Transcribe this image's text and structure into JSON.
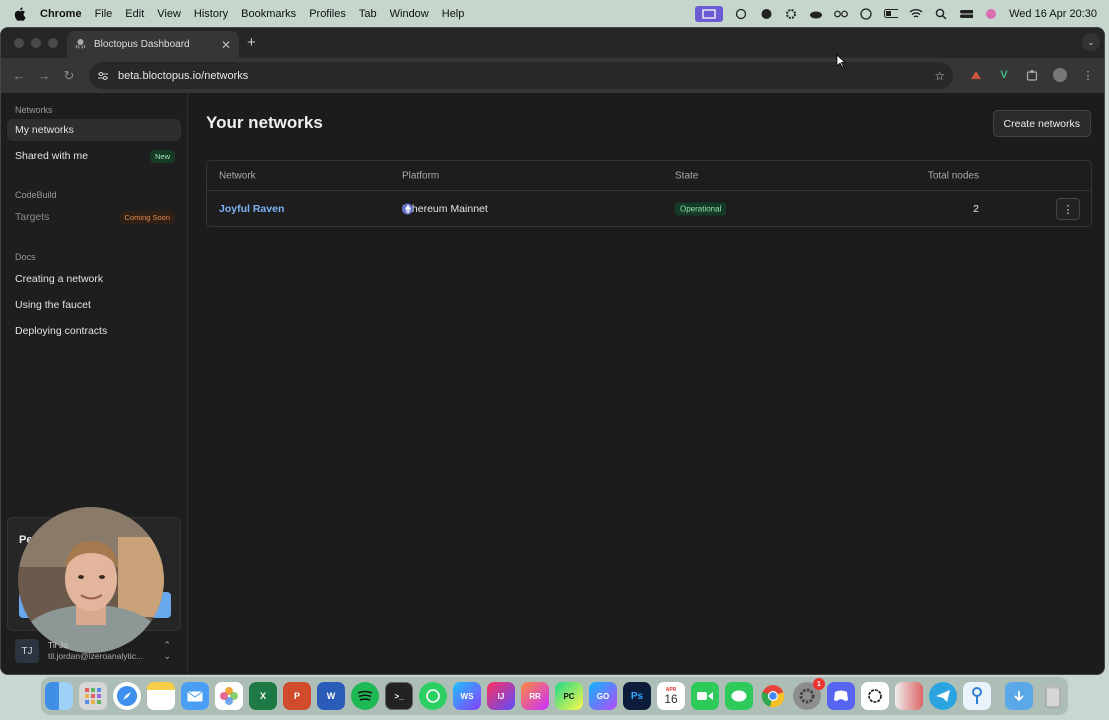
{
  "menubar": {
    "app": "Chrome",
    "items": [
      "File",
      "Edit",
      "View",
      "History",
      "Bookmarks",
      "Profiles",
      "Tab",
      "Window",
      "Help"
    ],
    "clock": "Wed 16 Apr  20:30"
  },
  "browser": {
    "tab_title": "Bloctopus Dashboard",
    "url": "beta.bloctopus.io/networks"
  },
  "sidebar": {
    "sections": [
      {
        "title": "Networks",
        "items": [
          {
            "label": "My networks",
            "active": true
          },
          {
            "label": "Shared with me",
            "badge": "New"
          }
        ]
      },
      {
        "title": "CodeBuild",
        "items": [
          {
            "label": "Targets",
            "badge": "Coming Soon"
          }
        ]
      },
      {
        "title": "Docs",
        "items": [
          {
            "label": "Creating a network"
          },
          {
            "label": "Using the faucet"
          },
          {
            "label": "Deploying contracts"
          }
        ]
      }
    ],
    "promo_title": "Pe",
    "user": {
      "initials": "TJ",
      "name": "Til Jo",
      "email": "til.jordan@lzeroanalytic..."
    }
  },
  "main": {
    "title": "Your networks",
    "create_button": "Create networks",
    "table": {
      "headers": [
        "Network",
        "Platform",
        "State",
        "Total nodes"
      ],
      "rows": [
        {
          "network": "Joyful Raven",
          "platform": "Ethereum Mainnet",
          "state": "Operational",
          "total_nodes": "2"
        }
      ]
    }
  },
  "dock": {
    "calendar_month": "APR",
    "calendar_day": "16",
    "notification_count": "1",
    "apps": [
      "finder-icon",
      "launchpad-icon",
      "safari-icon",
      "notes-icon",
      "mail-icon",
      "photos-icon",
      "excel-icon",
      "powerpoint-icon",
      "word-icon",
      "spotify-icon",
      "terminal-icon",
      "whatsapp-icon",
      "webstorm-icon",
      "intellij-icon",
      "rustrover-icon",
      "pycharm-icon",
      "goland-icon",
      "photoshop-icon",
      "calendar-icon",
      "facetime-icon",
      "messages-icon",
      "chrome-icon",
      "system-settings-icon",
      "discord-icon",
      "chatgpt-icon",
      "pencil-app-icon",
      "telegram-icon",
      "keychain-icon",
      "downloads-icon",
      "trash-icon"
    ]
  },
  "colors": {
    "accent_link": "#7db4f4",
    "operational_bg": "#143b27",
    "operational_fg": "#8fe0ae",
    "coming_soon": "#e0884a"
  }
}
